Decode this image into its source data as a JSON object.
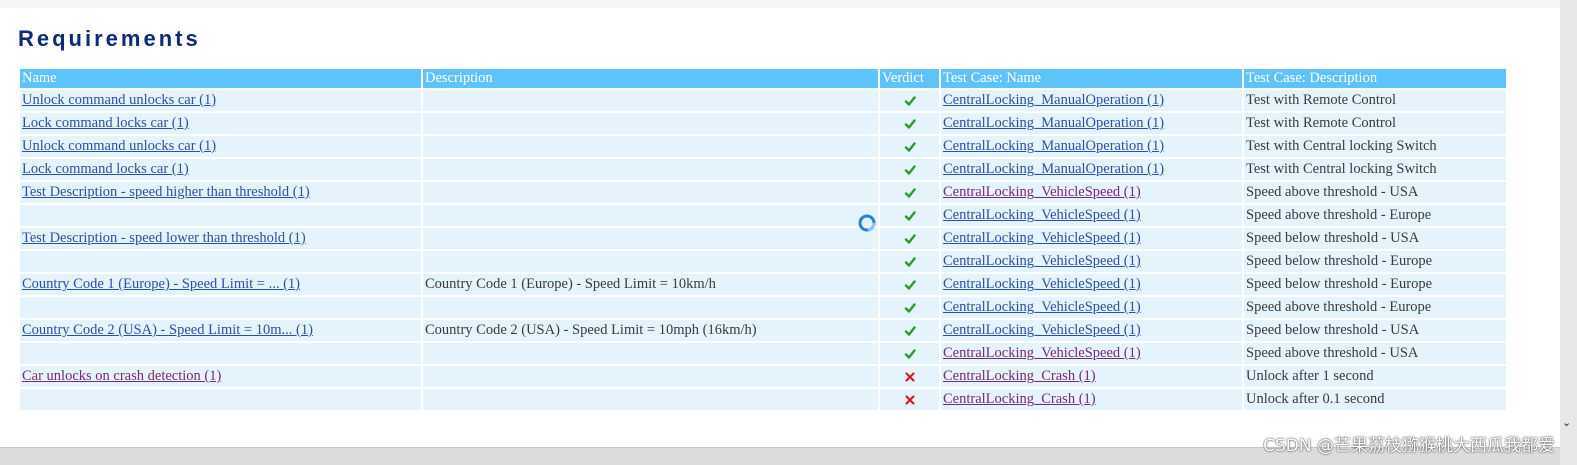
{
  "title": "Requirements",
  "columns": [
    "Name",
    "Description",
    "Verdict",
    "Test Case: Name",
    "Test Case: Description"
  ],
  "colors": {
    "header_bg": "#5ec3fb",
    "row_bg": "#e5f3fd",
    "title": "#0c2a7c",
    "link": "#2f50a8",
    "link_visited": "#7a2a74",
    "pass": "#2e9a2e",
    "fail": "#d42020"
  },
  "rows": [
    {
      "name": "Unlock command unlocks car (1)",
      "description": "",
      "verdict": "pass",
      "tc_name": "CentralLocking_ManualOperation (1)",
      "tc_description": "Test with Remote Control"
    },
    {
      "name": "Lock command locks car (1)",
      "description": "",
      "verdict": "pass",
      "tc_name": "CentralLocking_ManualOperation (1)",
      "tc_description": "Test with Remote Control"
    },
    {
      "name": "Unlock command unlocks car (1)",
      "description": "",
      "verdict": "pass",
      "tc_name": "CentralLocking_ManualOperation (1)",
      "tc_description": "Test with Central locking Switch"
    },
    {
      "name": "Lock command locks car (1)",
      "description": "",
      "verdict": "pass",
      "tc_name": "CentralLocking_ManualOperation (1)",
      "tc_description": "Test with Central locking Switch"
    },
    {
      "name": "Test Description - speed higher than threshold (1)",
      "description": "",
      "verdict": "pass",
      "tc_name": "CentralLocking_VehicleSpeed (1)",
      "tc_description": "Speed above threshold - USA"
    },
    {
      "name": "",
      "description": "",
      "verdict": "pass",
      "tc_name": "CentralLocking_VehicleSpeed (1)",
      "tc_description": "Speed above threshold - Europe"
    },
    {
      "name": "Test Description - speed lower than threshold (1)",
      "description": "",
      "verdict": "pass",
      "tc_name": "CentralLocking_VehicleSpeed (1)",
      "tc_description": "Speed below threshold - USA"
    },
    {
      "name": "",
      "description": "",
      "verdict": "pass",
      "tc_name": "CentralLocking_VehicleSpeed (1)",
      "tc_description": "Speed below threshold - Europe"
    },
    {
      "name": "Country Code 1 (Europe) - Speed Limit = ... (1)",
      "description": "Country Code 1 (Europe) - Speed Limit = 10km/h",
      "verdict": "pass",
      "tc_name": "CentralLocking_VehicleSpeed (1)",
      "tc_description": "Speed below threshold - Europe"
    },
    {
      "name": "",
      "description": "",
      "verdict": "pass",
      "tc_name": "CentralLocking_VehicleSpeed (1)",
      "tc_description": "Speed above threshold - Europe"
    },
    {
      "name": "Country Code 2 (USA) - Speed Limit = 10m... (1)",
      "description": "Country Code 2 (USA) - Speed Limit = 10mph (16km/h)",
      "verdict": "pass",
      "tc_name": "CentralLocking_VehicleSpeed (1)",
      "tc_description": "Speed below threshold - USA"
    },
    {
      "name": "",
      "description": "",
      "verdict": "pass",
      "tc_name": "CentralLocking_VehicleSpeed (1)",
      "tc_description": "Speed above threshold - USA"
    },
    {
      "name": "Car unlocks on crash detection (1)",
      "description": "",
      "verdict": "fail",
      "tc_name": "CentralLocking_Crash (1)",
      "tc_description": "Unlock after 1 second"
    },
    {
      "name": "",
      "description": "",
      "verdict": "fail",
      "tc_name": "CentralLocking_Crash (1)",
      "tc_description": "Unlock after 0.1 second"
    }
  ],
  "watermark": "CSDN @芒果荔枝猕猴桃大西瓜我都爱"
}
